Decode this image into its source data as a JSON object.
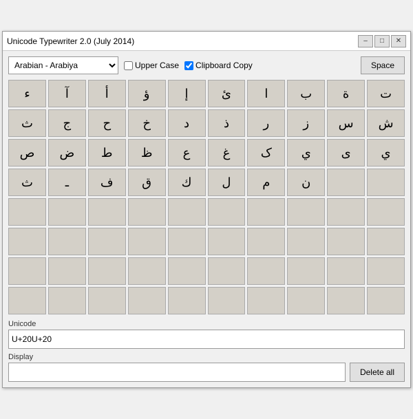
{
  "window": {
    "title": "Unicode Typewriter 2.0 (July 2014)",
    "controls": {
      "minimize": "–",
      "maximize": "□",
      "close": "✕"
    }
  },
  "toolbar": {
    "language_value": "Arabian      - Arabiya",
    "uppercase_label": "Upper Case",
    "clipboard_label": "Clipboard Copy",
    "clipboard_checked": true,
    "uppercase_checked": false,
    "space_label": "Space"
  },
  "characters": [
    "ء",
    "آ",
    "أ",
    "ؤ",
    "إ",
    "ئ",
    "ا",
    "ب",
    "ة",
    "ت",
    "ث",
    "ج",
    "ح",
    "خ",
    "د",
    "ذ",
    "ر",
    "ز",
    "س",
    "ش",
    "ص",
    "ض",
    "ط",
    "ظ",
    "ع",
    "غ",
    "ک",
    "ي",
    "ى",
    "ي",
    "ث",
    "ـ",
    "ف",
    "ق",
    "ك",
    "ل",
    "م",
    "ن",
    "",
    "",
    "",
    "",
    "",
    "",
    "",
    "",
    "",
    "",
    "",
    "",
    "",
    "",
    "",
    "",
    "",
    "",
    "",
    "",
    "",
    "",
    "",
    "",
    "",
    "",
    "",
    "",
    "",
    "",
    "",
    "",
    "",
    "",
    "",
    "",
    "",
    "",
    "",
    "",
    "",
    ""
  ],
  "unicode_label": "Unicode",
  "unicode_value": "U+20U+20",
  "display_label": "Display",
  "display_value": "",
  "delete_all_label": "Delete all"
}
